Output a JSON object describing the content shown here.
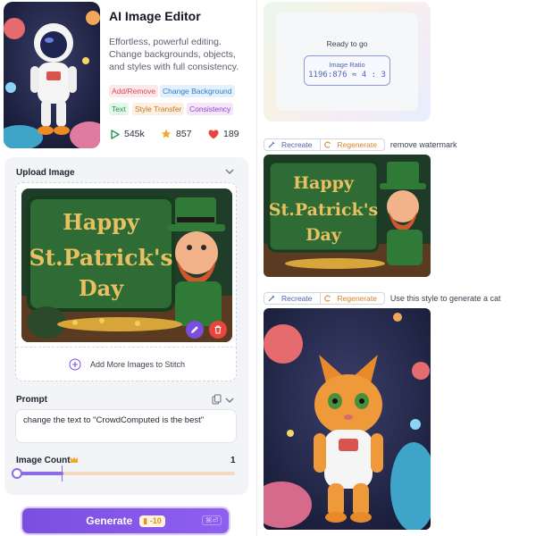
{
  "tool": {
    "title": "AI Image Editor",
    "description": "Effortless, powerful editing. Change backgrounds, objects, and styles with full consistency.",
    "tags": [
      {
        "label": "Add/Remove",
        "color": "#d94a57",
        "bg": "#fde8ea"
      },
      {
        "label": "Change Background",
        "color": "#2a7fc9",
        "bg": "#e4f1fc"
      },
      {
        "label": "Text",
        "color": "#27924a",
        "bg": "#e4f6ea"
      },
      {
        "label": "Style Transfer",
        "color": "#c5742a",
        "bg": "#fdf0e2"
      },
      {
        "label": "Consistency",
        "color": "#9b3fc4",
        "bg": "#f4e6fb"
      }
    ],
    "stats": {
      "plays": "545k",
      "stars": "857",
      "likes": "189"
    }
  },
  "upload": {
    "label": "Upload Image",
    "preview_alt_text": [
      "Happy",
      "St.Patrick's",
      "Day"
    ],
    "add_more": "Add More Images to Stitch"
  },
  "prompt": {
    "label": "Prompt",
    "value": "change the text to \"CrowdComputed is the best\""
  },
  "image_count": {
    "label": "Image Count",
    "value": "1",
    "fraction": 0.0
  },
  "generate": {
    "label": "Generate",
    "credit": "-10",
    "shortcut": "⌘⏎"
  },
  "ready": {
    "status": "Ready to go",
    "ratio_label": "Image Ratio",
    "ratio_value": "1196:876 ≈ 4 : 3"
  },
  "history": [
    {
      "recreate": "Recreate",
      "regenerate": "Regenerate",
      "prompt": "remove watermark",
      "image_text": [
        "Happy",
        "St.Patrick's",
        "Day"
      ]
    },
    {
      "recreate": "Recreate",
      "regenerate": "Regenerate",
      "prompt": "Use this style to generate a cat"
    }
  ],
  "colors": {
    "accent": "#7a4fe0",
    "green": "#2f6b34",
    "gold": "#e8c062"
  }
}
